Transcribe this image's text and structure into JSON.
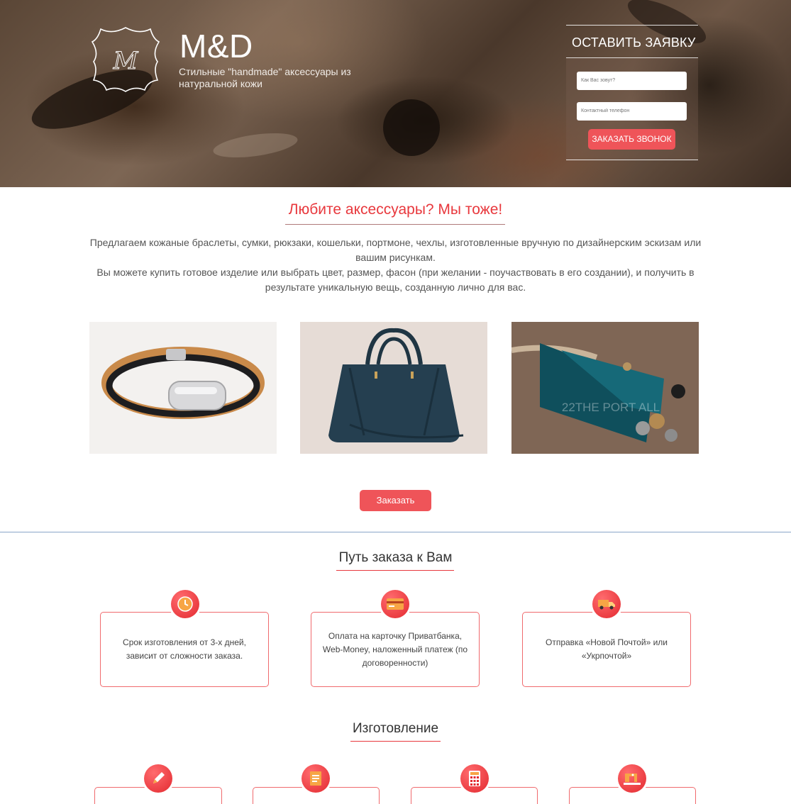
{
  "header": {
    "brand": "M&D",
    "tagline": "Стильные \"handmade\" аксессуары из натуральной кожи",
    "logo_icon": "leather-hide-logo",
    "logo_monogram": "М"
  },
  "request_form": {
    "title": "ОСТАВИТЬ ЗАЯВКУ",
    "name_placeholder": "Как Вас зовут?",
    "phone_placeholder": "Контактный телефон",
    "submit_label": "ЗАКАЗАТЬ ЗВОНОК"
  },
  "intro": {
    "title": "Любите аксессуары? Мы тоже!",
    "paragraph_1": "Предлагаем кожаные браслеты, сумки, рюкзаки, кошельки, портмоне, чехлы, изготовленные вручную по дизайнерским эскизам или вашим рисункам.",
    "paragraph_2": "Вы можете купить готовое изделие или выбрать цвет, размер, фасон (при желании - поучаствовать в его создании), и получить в результате уникальную вещь, созданную лично для вас."
  },
  "products": [
    {
      "name": "leather-bracelet-photo"
    },
    {
      "name": "leather-handbag-photo"
    },
    {
      "name": "leather-wallet-photo",
      "watermark": "22THE PORT ALL"
    }
  ],
  "order_button": "Заказать",
  "order_path": {
    "title": "Путь заказа к Вам",
    "steps": [
      {
        "icon": "clock-icon",
        "text": "Срок изготовления от 3-х дней, зависит от сложности заказа."
      },
      {
        "icon": "credit-card-icon",
        "text": "Оплата на карточку Приватбанка, Web-Money, наложенный платеж (по договоренности)"
      },
      {
        "icon": "delivery-truck-icon",
        "text": "Отправка «Новой Почтой» или «Укрпочтой»"
      }
    ]
  },
  "manufacturing": {
    "title": "Изготовление",
    "steps": [
      {
        "icon": "pencil-icon"
      },
      {
        "icon": "document-icon"
      },
      {
        "icon": "calculator-icon"
      },
      {
        "icon": "sewing-machine-icon"
      }
    ]
  },
  "colors": {
    "accent": "#ef5459",
    "title_red": "#e8383d",
    "card_border": "#f06a6d"
  }
}
